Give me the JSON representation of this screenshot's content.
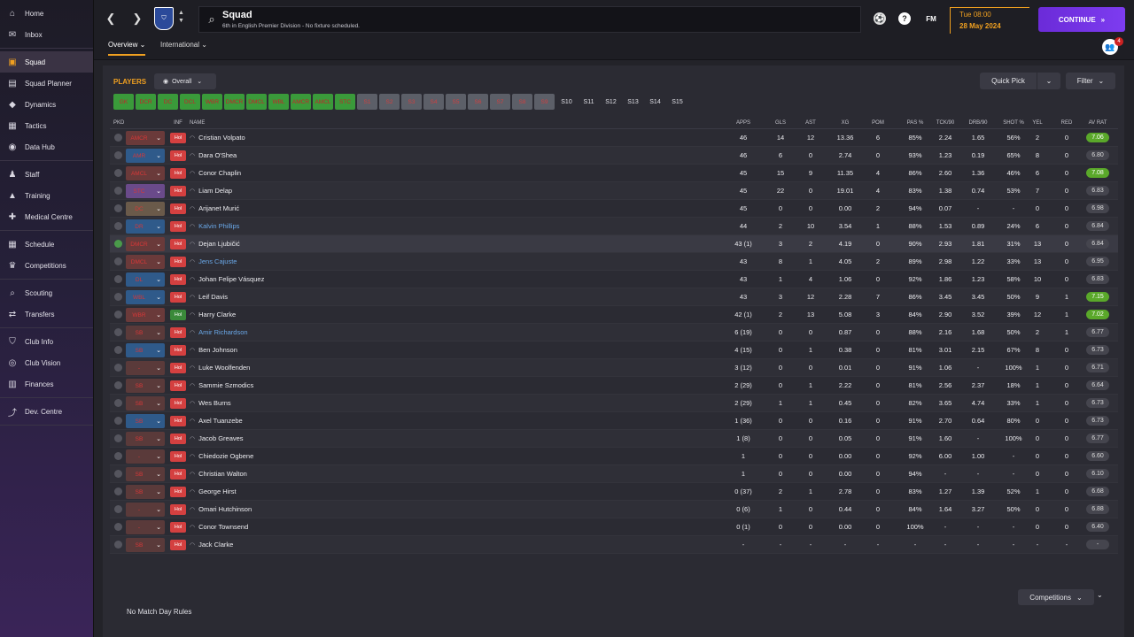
{
  "sidebar": {
    "items": [
      {
        "label": "Home",
        "icon": "home-icon",
        "glyph": "⌂"
      },
      {
        "label": "Inbox",
        "icon": "inbox-icon",
        "glyph": "✉"
      },
      {
        "label": "Squad",
        "icon": "squad-icon",
        "glyph": "▣",
        "active": true
      },
      {
        "label": "Squad Planner",
        "icon": "squad-planner-icon",
        "glyph": "▤"
      },
      {
        "label": "Dynamics",
        "icon": "dynamics-icon",
        "glyph": "◆"
      },
      {
        "label": "Tactics",
        "icon": "tactics-icon",
        "glyph": "▦"
      },
      {
        "label": "Data Hub",
        "icon": "data-hub-icon",
        "glyph": "◉"
      },
      {
        "label": "Staff",
        "icon": "staff-icon",
        "glyph": "♟"
      },
      {
        "label": "Training",
        "icon": "training-icon",
        "glyph": "▲"
      },
      {
        "label": "Medical Centre",
        "icon": "medical-icon",
        "glyph": "✚"
      },
      {
        "label": "Schedule",
        "icon": "schedule-icon",
        "glyph": "▦"
      },
      {
        "label": "Competitions",
        "icon": "trophy-icon",
        "glyph": "♛"
      },
      {
        "label": "Scouting",
        "icon": "scouting-icon",
        "glyph": "⌕"
      },
      {
        "label": "Transfers",
        "icon": "transfers-icon",
        "glyph": "⇄"
      },
      {
        "label": "Club Info",
        "icon": "club-info-icon",
        "glyph": "⛉"
      },
      {
        "label": "Club Vision",
        "icon": "club-vision-icon",
        "glyph": "◎"
      },
      {
        "label": "Finances",
        "icon": "finances-icon",
        "glyph": "▥"
      },
      {
        "label": "Dev. Centre",
        "icon": "dev-centre-icon",
        "glyph": "⤴"
      }
    ]
  },
  "header": {
    "title": "Squad",
    "subtitle": "6th in English Premier Division - No fixture scheduled.",
    "fm_label": "FM",
    "time": "Tue 08:00",
    "date": "28 May 2024",
    "continue": "CONTINUE",
    "tabs": [
      "Overview",
      "International"
    ],
    "notifications": "4"
  },
  "toolbar": {
    "players_label": "PLAYERS",
    "view": "Overall",
    "quick_pick": "Quick Pick",
    "filter": "Filter"
  },
  "positions": [
    {
      "label": "GK",
      "style": "green"
    },
    {
      "label": "DCR",
      "style": "green"
    },
    {
      "label": "DC",
      "style": "green"
    },
    {
      "label": "DCL",
      "style": "green"
    },
    {
      "label": "WBR",
      "style": "green"
    },
    {
      "label": "DMCR",
      "style": "green"
    },
    {
      "label": "DMCL",
      "style": "green"
    },
    {
      "label": "WBL",
      "style": "green"
    },
    {
      "label": "AMCR",
      "style": "green"
    },
    {
      "label": "AMCL",
      "style": "green"
    },
    {
      "label": "STC",
      "style": "green"
    },
    {
      "label": "S1",
      "style": "gray"
    },
    {
      "label": "S2",
      "style": "gray"
    },
    {
      "label": "S3",
      "style": "gray"
    },
    {
      "label": "S4",
      "style": "gray"
    },
    {
      "label": "S5",
      "style": "gray"
    },
    {
      "label": "S6",
      "style": "gray"
    },
    {
      "label": "S7",
      "style": "gray"
    },
    {
      "label": "S8",
      "style": "gray"
    },
    {
      "label": "S9",
      "style": "gray"
    },
    {
      "label": "S10",
      "style": "plain"
    },
    {
      "label": "S11",
      "style": "plain"
    },
    {
      "label": "S12",
      "style": "plain"
    },
    {
      "label": "S13",
      "style": "plain"
    },
    {
      "label": "S14",
      "style": "plain"
    },
    {
      "label": "S15",
      "style": "plain"
    }
  ],
  "columns": {
    "pkd": "PKD",
    "inf": "INF",
    "name": "NAME",
    "apps": "APPS",
    "gls": "GLS",
    "ast": "AST",
    "xg": "XG",
    "pom": "POM",
    "pas": "PAS %",
    "tck": "TCK/90",
    "drb": "DRB/90",
    "shot": "SHOT %",
    "yel": "YEL",
    "red": "RED",
    "av": "AV RAT"
  },
  "players": [
    {
      "pos": "AMCR",
      "pos_color": "#6a3a3a",
      "inf": "Hol",
      "name": "Cristian Volpato",
      "apps": "46",
      "gls": "14",
      "ast": "12",
      "xg": "13.36",
      "pom": "6",
      "pas": "85%",
      "tck": "2.24",
      "drb": "1.65",
      "shot": "56%",
      "yel": "2",
      "red": "0",
      "av": "7.06",
      "hi": true
    },
    {
      "pos": "AMR",
      "pos_color": "#2f5a8a",
      "inf": "Hol",
      "name": "Dara O'Shea",
      "apps": "46",
      "gls": "6",
      "ast": "0",
      "xg": "2.74",
      "pom": "0",
      "pas": "93%",
      "tck": "1.23",
      "drb": "0.19",
      "shot": "65%",
      "yel": "8",
      "red": "0",
      "av": "6.80"
    },
    {
      "pos": "AMCL",
      "pos_color": "#6a3a3a",
      "inf": "Hol",
      "name": "Conor Chaplin",
      "apps": "45",
      "gls": "15",
      "ast": "9",
      "xg": "11.35",
      "pom": "4",
      "pas": "86%",
      "tck": "2.60",
      "drb": "1.36",
      "shot": "46%",
      "yel": "6",
      "red": "0",
      "av": "7.08",
      "hi": true
    },
    {
      "pos": "STC",
      "pos_color": "#6a4a8a",
      "inf": "Hol",
      "name": "Liam Delap",
      "apps": "45",
      "gls": "22",
      "ast": "0",
      "xg": "19.01",
      "pom": "4",
      "pas": "83%",
      "tck": "1.38",
      "drb": "0.74",
      "shot": "53%",
      "yel": "7",
      "red": "0",
      "av": "6.83"
    },
    {
      "pos": "DC",
      "pos_color": "#6a5a4a",
      "inf": "Hol",
      "name": "Arijanet Murić",
      "apps": "45",
      "gls": "0",
      "ast": "0",
      "xg": "0.00",
      "pom": "2",
      "pas": "94%",
      "tck": "0.07",
      "drb": "-",
      "shot": "-",
      "yel": "0",
      "red": "0",
      "av": "6.98"
    },
    {
      "pos": "DR",
      "pos_color": "#2f5a8a",
      "inf": "Hol",
      "name": "Kalvin Phillips",
      "apps": "44",
      "gls": "2",
      "ast": "10",
      "xg": "3.54",
      "pom": "1",
      "pas": "88%",
      "tck": "1.53",
      "drb": "0.89",
      "shot": "24%",
      "yel": "6",
      "red": "0",
      "av": "6.84",
      "link": true
    },
    {
      "pos": "DMCR",
      "pos_color": "#6a3a3a",
      "inf": "Hol",
      "name": "Dejan Ljubičić",
      "apps": "43 (1)",
      "gls": "3",
      "ast": "2",
      "xg": "4.19",
      "pom": "0",
      "pas": "90%",
      "tck": "2.93",
      "drb": "1.81",
      "shot": "31%",
      "yel": "13",
      "red": "0",
      "av": "6.84",
      "sel": true,
      "ok": true
    },
    {
      "pos": "DMCL",
      "pos_color": "#6a3a3a",
      "inf": "Hol",
      "name": "Jens Cajuste",
      "apps": "43",
      "gls": "8",
      "ast": "1",
      "xg": "4.05",
      "pom": "2",
      "pas": "89%",
      "tck": "2.98",
      "drb": "1.22",
      "shot": "33%",
      "yel": "13",
      "red": "0",
      "av": "6.95",
      "link": true
    },
    {
      "pos": "DL",
      "pos_color": "#2f5a8a",
      "inf": "Hol",
      "name": "Johan Felipe Vásquez",
      "apps": "43",
      "gls": "1",
      "ast": "4",
      "xg": "1.06",
      "pom": "0",
      "pas": "92%",
      "tck": "1.86",
      "drb": "1.23",
      "shot": "58%",
      "yel": "10",
      "red": "0",
      "av": "6.83"
    },
    {
      "pos": "WBL",
      "pos_color": "#2f5a8a",
      "inf": "Hol",
      "name": "Leif Davis",
      "apps": "43",
      "gls": "3",
      "ast": "12",
      "xg": "2.28",
      "pom": "7",
      "pas": "86%",
      "tck": "3.45",
      "drb": "3.45",
      "shot": "50%",
      "yel": "9",
      "red": "1",
      "av": "7.15",
      "hi": true
    },
    {
      "pos": "WBR",
      "pos_color": "#6a3a3a",
      "inf": "Hol",
      "name": "Harry Clarke",
      "apps": "42 (1)",
      "gls": "2",
      "ast": "13",
      "xg": "5.08",
      "pom": "3",
      "pas": "84%",
      "tck": "2.90",
      "drb": "3.52",
      "shot": "39%",
      "yel": "12",
      "red": "1",
      "av": "7.02",
      "hi": true,
      "grn": true
    },
    {
      "pos": "SB",
      "pos_color": "#5a3a3a",
      "inf": "Hol",
      "name": "Amir Richardson",
      "apps": "6 (19)",
      "gls": "0",
      "ast": "0",
      "xg": "0.87",
      "pom": "0",
      "pas": "88%",
      "tck": "2.16",
      "drb": "1.68",
      "shot": "50%",
      "yel": "2",
      "red": "1",
      "av": "6.77",
      "link": true
    },
    {
      "pos": "SB",
      "pos_color": "#2f5a8a",
      "inf": "Hol",
      "name": "Ben Johnson",
      "apps": "4 (15)",
      "gls": "0",
      "ast": "1",
      "xg": "0.38",
      "pom": "0",
      "pas": "81%",
      "tck": "3.01",
      "drb": "2.15",
      "shot": "67%",
      "yel": "8",
      "red": "0",
      "av": "6.73"
    },
    {
      "pos": "-",
      "pos_color": "#5a3a3a",
      "inf": "Hol",
      "name": "Luke Woolfenden",
      "apps": "3 (12)",
      "gls": "0",
      "ast": "0",
      "xg": "0.01",
      "pom": "0",
      "pas": "91%",
      "tck": "1.06",
      "drb": "-",
      "shot": "100%",
      "yel": "1",
      "red": "0",
      "av": "6.71"
    },
    {
      "pos": "SB",
      "pos_color": "#5a3a3a",
      "inf": "Hol",
      "name": "Sammie Szmodics",
      "apps": "2 (29)",
      "gls": "0",
      "ast": "1",
      "xg": "2.22",
      "pom": "0",
      "pas": "81%",
      "tck": "2.56",
      "drb": "2.37",
      "shot": "18%",
      "yel": "1",
      "red": "0",
      "av": "6.64"
    },
    {
      "pos": "SB",
      "pos_color": "#5a3a3a",
      "inf": "Hol",
      "name": "Wes Burns",
      "apps": "2 (29)",
      "gls": "1",
      "ast": "1",
      "xg": "0.45",
      "pom": "0",
      "pas": "82%",
      "tck": "3.65",
      "drb": "4.74",
      "shot": "33%",
      "yel": "1",
      "red": "0",
      "av": "6.73"
    },
    {
      "pos": "SB",
      "pos_color": "#2f5a8a",
      "inf": "Hol",
      "name": "Axel Tuanzebe",
      "apps": "1 (36)",
      "gls": "0",
      "ast": "0",
      "xg": "0.16",
      "pom": "0",
      "pas": "91%",
      "tck": "2.70",
      "drb": "0.64",
      "shot": "80%",
      "yel": "0",
      "red": "0",
      "av": "6.73"
    },
    {
      "pos": "SB",
      "pos_color": "#5a3a3a",
      "inf": "Hol",
      "name": "Jacob Greaves",
      "apps": "1 (8)",
      "gls": "0",
      "ast": "0",
      "xg": "0.05",
      "pom": "0",
      "pas": "91%",
      "tck": "1.60",
      "drb": "-",
      "shot": "100%",
      "yel": "0",
      "red": "0",
      "av": "6.77"
    },
    {
      "pos": "-",
      "pos_color": "#5a3a3a",
      "inf": "Hol",
      "name": "Chiedozie Ogbene",
      "apps": "1",
      "gls": "0",
      "ast": "0",
      "xg": "0.00",
      "pom": "0",
      "pas": "92%",
      "tck": "6.00",
      "drb": "1.00",
      "shot": "-",
      "yel": "0",
      "red": "0",
      "av": "6.60"
    },
    {
      "pos": "SB",
      "pos_color": "#5a3a3a",
      "inf": "Hol",
      "name": "Christian Walton",
      "apps": "1",
      "gls": "0",
      "ast": "0",
      "xg": "0.00",
      "pom": "0",
      "pas": "94%",
      "tck": "-",
      "drb": "-",
      "shot": "-",
      "yel": "0",
      "red": "0",
      "av": "6.10"
    },
    {
      "pos": "SB",
      "pos_color": "#5a3a3a",
      "inf": "Hol",
      "name": "George Hirst",
      "apps": "0 (37)",
      "gls": "2",
      "ast": "1",
      "xg": "2.78",
      "pom": "0",
      "pas": "83%",
      "tck": "1.27",
      "drb": "1.39",
      "shot": "52%",
      "yel": "1",
      "red": "0",
      "av": "6.68"
    },
    {
      "pos": "-",
      "pos_color": "#5a3a3a",
      "inf": "Hol",
      "name": "Omari Hutchinson",
      "apps": "0 (6)",
      "gls": "1",
      "ast": "0",
      "xg": "0.44",
      "pom": "0",
      "pas": "84%",
      "tck": "1.64",
      "drb": "3.27",
      "shot": "50%",
      "yel": "0",
      "red": "0",
      "av": "6.88"
    },
    {
      "pos": "-",
      "pos_color": "#5a3a3a",
      "inf": "Hol",
      "name": "Conor Townsend",
      "apps": "0 (1)",
      "gls": "0",
      "ast": "0",
      "xg": "0.00",
      "pom": "0",
      "pas": "100%",
      "tck": "-",
      "drb": "-",
      "shot": "-",
      "yel": "0",
      "red": "0",
      "av": "6.40"
    },
    {
      "pos": "SB",
      "pos_color": "#5a3a3a",
      "inf": "Hol",
      "name": "Jack Clarke",
      "apps": "-",
      "gls": "-",
      "ast": "-",
      "xg": "-",
      "pom": "-",
      "pas": "-",
      "tck": "-",
      "drb": "-",
      "shot": "-",
      "yel": "-",
      "red": "-",
      "av": "-"
    }
  ],
  "footer": {
    "competitions": "Competitions",
    "no_rules": "No Match Day Rules"
  }
}
